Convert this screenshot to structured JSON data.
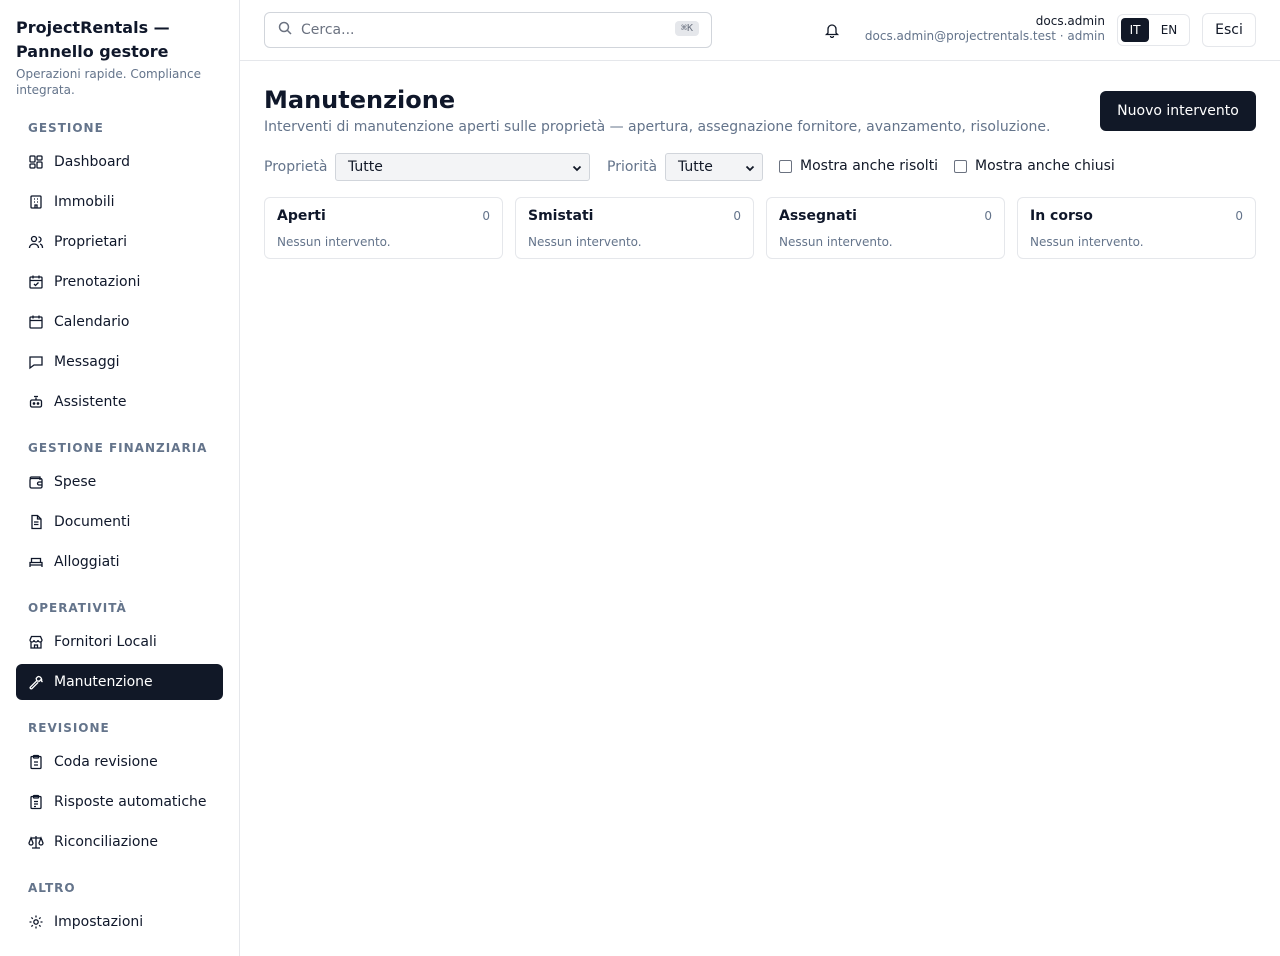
{
  "brand": {
    "title": "ProjectRentals — Pannello gestore",
    "subtitle": "Operazioni rapide. Compliance integrata."
  },
  "sidebar": {
    "sections": [
      {
        "title": "GESTIONE",
        "items": [
          {
            "label": "Dashboard",
            "icon": "dashboard-icon"
          },
          {
            "label": "Immobili",
            "icon": "building-icon"
          },
          {
            "label": "Proprietari",
            "icon": "users-icon"
          },
          {
            "label": "Prenotazioni",
            "icon": "calendar-check-icon"
          },
          {
            "label": "Calendario",
            "icon": "calendar-icon"
          },
          {
            "label": "Messaggi",
            "icon": "message-icon"
          },
          {
            "label": "Assistente",
            "icon": "bot-icon"
          }
        ]
      },
      {
        "title": "GESTIONE FINANZIARIA",
        "items": [
          {
            "label": "Spese",
            "icon": "wallet-icon"
          },
          {
            "label": "Documenti",
            "icon": "document-icon"
          },
          {
            "label": "Alloggiati",
            "icon": "bed-icon"
          }
        ]
      },
      {
        "title": "OPERATIVITÀ",
        "items": [
          {
            "label": "Fornitori Locali",
            "icon": "store-icon"
          },
          {
            "label": "Manutenzione",
            "icon": "wrench-icon"
          }
        ]
      },
      {
        "title": "REVISIONE",
        "items": [
          {
            "label": "Coda revisione",
            "icon": "clipboard-icon"
          },
          {
            "label": "Risposte automatiche",
            "icon": "clipboard-list-icon"
          },
          {
            "label": "Riconciliazione",
            "icon": "scale-icon"
          }
        ]
      },
      {
        "title": "ALTRO",
        "items": [
          {
            "label": "Impostazioni",
            "icon": "gear-icon"
          }
        ]
      }
    ],
    "active": "Manutenzione"
  },
  "header": {
    "search_placeholder": "Cerca...",
    "search_shortcut": "⌘K",
    "user_name": "docs.admin",
    "user_email": "docs.admin@projectrentals.test · admin",
    "lang_it": "IT",
    "lang_en": "EN",
    "active_lang": "IT",
    "logout_label": "Esci"
  },
  "main": {
    "title": "Manutenzione",
    "subtitle": "Interventi di manutenzione aperti sulle proprietà — apertura, assegnazione fornitore, avanzamento, risoluzione.",
    "new_button": "Nuovo intervento",
    "filters": {
      "property_label": "Proprietà",
      "property_value": "Tutte",
      "priority_label": "Priorità",
      "priority_value": "Tutte",
      "show_resolved": "Mostra anche risolti",
      "show_closed": "Mostra anche chiusi"
    },
    "columns": [
      {
        "title": "Aperti",
        "count": "0",
        "empty": "Nessun intervento."
      },
      {
        "title": "Smistati",
        "count": "0",
        "empty": "Nessun intervento."
      },
      {
        "title": "Assegnati",
        "count": "0",
        "empty": "Nessun intervento."
      },
      {
        "title": "In corso",
        "count": "0",
        "empty": "Nessun intervento."
      }
    ]
  },
  "colors": {
    "accent": "#111827",
    "muted": "#64748b",
    "border": "#e5e7eb"
  }
}
